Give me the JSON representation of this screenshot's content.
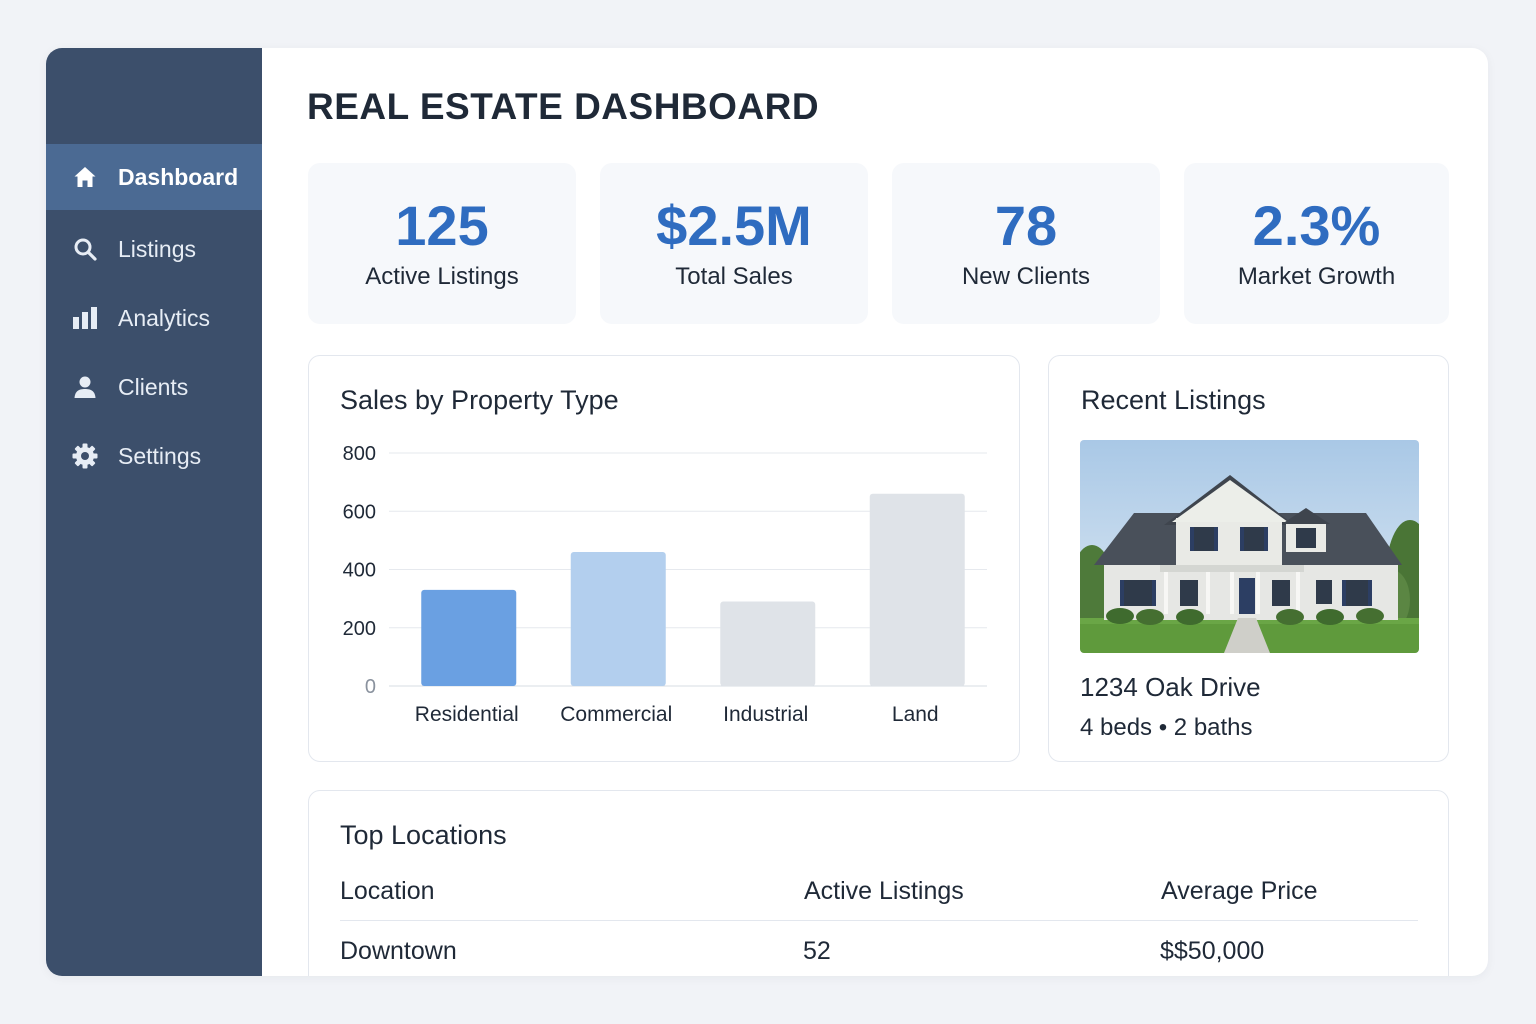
{
  "page": {
    "title": "REAL ESTATE DASHBOARD"
  },
  "colors": {
    "sidebar": "#3c4f6b",
    "sidebar_active": "#4b6a93",
    "accent": "#2f6cc0"
  },
  "sidebar": {
    "items": [
      {
        "label": "Dashboard",
        "icon": "home-icon",
        "active": true
      },
      {
        "label": "Listings",
        "icon": "search-icon",
        "active": false
      },
      {
        "label": "Analytics",
        "icon": "bar-chart-icon",
        "active": false
      },
      {
        "label": "Clients",
        "icon": "user-icon",
        "active": false
      },
      {
        "label": "Settings",
        "icon": "gear-icon",
        "active": false
      }
    ]
  },
  "kpis": [
    {
      "value": "125",
      "label": "Active Listings"
    },
    {
      "value": "$2.5M",
      "label": "Total Sales"
    },
    {
      "value": "78",
      "label": "New Clients"
    },
    {
      "value": "2.3%",
      "label": "Market Growth"
    }
  ],
  "sales_chart": {
    "title": "Sales by Property Type"
  },
  "chart_data": {
    "type": "bar",
    "title": "Sales by Property Type",
    "categories": [
      "Residential",
      "Commercial",
      "Industrial",
      "Land"
    ],
    "values": [
      330,
      460,
      290,
      660
    ],
    "bar_colors": [
      "#6aa0e2",
      "#b3cfee",
      "#dfe3e8",
      "#dfe3e8"
    ],
    "ylim": [
      0,
      800
    ],
    "yticks": [
      0,
      200,
      400,
      600,
      800
    ],
    "grid": true
  },
  "recent_listings": {
    "title": "Recent Listings",
    "image": "house-photo",
    "address": "1234 Oak Drive",
    "specs": "4 beds • 2 baths"
  },
  "top_locations": {
    "title": "Top Locations",
    "columns": [
      "Location",
      "Active Listings",
      "Average Price"
    ],
    "rows": [
      [
        "Downtown",
        "52",
        "$$50,000"
      ]
    ]
  }
}
